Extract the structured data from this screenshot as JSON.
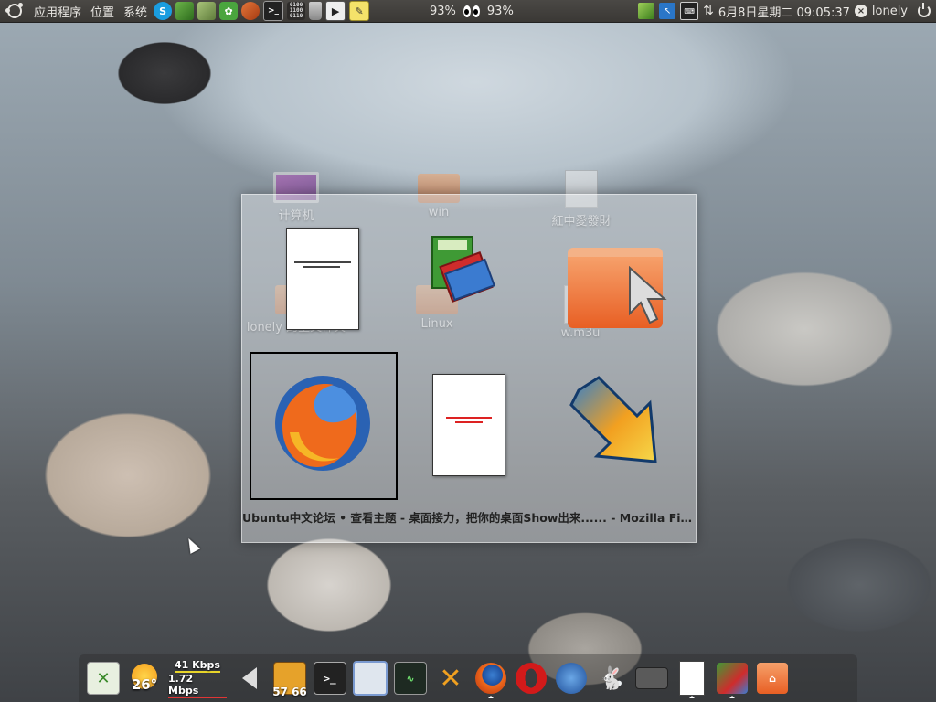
{
  "top_panel": {
    "menus": [
      "应用程序",
      "位置",
      "系统"
    ],
    "launchers": [
      "skype-icon",
      "books-icon",
      "box-icon",
      "gear-icon",
      "firefox-icon",
      "terminal-icon",
      "binary-icon",
      "trash-icon",
      "run-icon",
      "edit-icon"
    ],
    "cpu_left": "93%",
    "cpu_right": "93%",
    "clock": "6月8日星期二 09:05:37",
    "username": "lonely"
  },
  "desktop_icons": [
    {
      "label": "计算机"
    },
    {
      "label": "win"
    },
    {
      "label": "紅中愛發財"
    },
    {
      "label": "lonely 的主文件夹"
    },
    {
      "label": "Linux"
    },
    {
      "label": "w.m3u"
    }
  ],
  "switcher": {
    "caption": "Ubuntu中文论坛 • 查看主题 - 桌面接力，把你的桌面Show出来...... - Mozilla Fir..."
  },
  "dock": {
    "temperature": "26°",
    "net_up": "41 Kbps",
    "net_down": "1.72 Mbps",
    "cpu_label": "57 66"
  }
}
